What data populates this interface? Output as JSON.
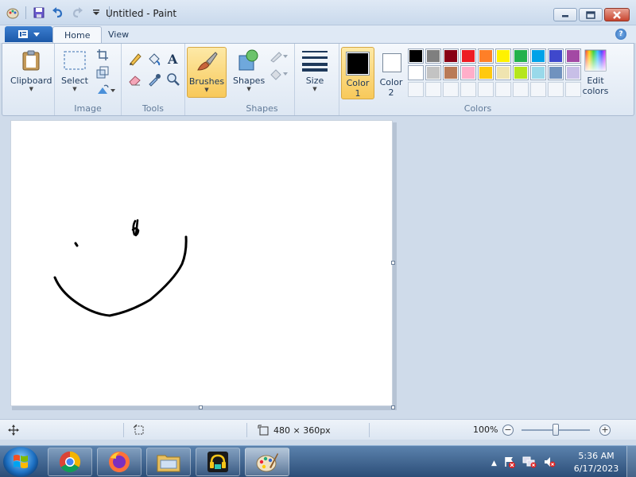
{
  "window": {
    "title": "Untitled - Paint"
  },
  "tabs": {
    "home": "Home",
    "view": "View"
  },
  "ribbon": {
    "clipboard": {
      "button": "Clipboard",
      "group": ""
    },
    "image": {
      "select": "Select",
      "group": "Image"
    },
    "tools": {
      "group": "Tools",
      "icons": [
        "pencil-icon",
        "fill-icon",
        "text-icon",
        "eraser-icon",
        "color-picker-icon",
        "magnifier-icon"
      ]
    },
    "brushes": {
      "button": "Brushes"
    },
    "shapes": {
      "button": "Shapes",
      "group": "Shapes"
    },
    "size": {
      "button": "Size"
    },
    "color1": {
      "label": "Color",
      "num": "1",
      "value": "#000000"
    },
    "color2": {
      "label": "Color",
      "num": "2",
      "value": "#ffffff"
    },
    "colors": {
      "group": "Colors"
    },
    "edit_colors": {
      "label": "Edit colors"
    }
  },
  "palette": {
    "row1": [
      "#000000",
      "#7f7f7f",
      "#880015",
      "#ed1c24",
      "#ff7f27",
      "#fff200",
      "#22b14c",
      "#00a2e8",
      "#3f48cc",
      "#a349a4"
    ],
    "row2": [
      "#ffffff",
      "#c3c3c3",
      "#b97a57",
      "#ffaec9",
      "#ffc90e",
      "#efe4b0",
      "#b5e61d",
      "#99d9ea",
      "#7092be",
      "#c8bfe7"
    ],
    "row3": [
      "",
      "",
      "",
      "",
      "",
      "",
      "",
      "",
      "",
      ""
    ]
  },
  "status": {
    "canvas_size": "480 × 360px",
    "zoom": "100%",
    "zoom_level_fraction": 0.5
  },
  "taskbar": {
    "apps": [
      "chrome-icon",
      "firefox-icon",
      "file-explorer-icon",
      "media-app-icon",
      "paint-icon"
    ],
    "time": "5:36 AM",
    "date": "6/17/2023"
  }
}
